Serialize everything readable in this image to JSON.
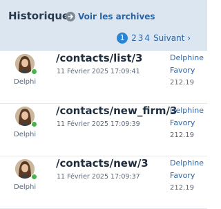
{
  "header": {
    "title": "Historique",
    "archives_label": "Voir les archives",
    "arrow_icon": "arrow-right-circle-icon"
  },
  "pagination": {
    "current": "1",
    "pages": [
      "2",
      "3",
      "4"
    ],
    "next_label": "Suivant ›"
  },
  "entries": [
    {
      "path": "/contacts/list/3",
      "date": "11 Février 2025 17:09:41",
      "user_short": "Delphi",
      "user_first": "Delphine",
      "user_last": "Favory",
      "ip": "212.19"
    },
    {
      "path": "/contacts/new_firm/3",
      "date": "11 Février 2025 17:09:39",
      "user_short": "Delphi",
      "user_first": "Delphine",
      "user_last": "Favory",
      "ip": "212.19"
    },
    {
      "path": "/contacts/new/3",
      "date": "11 Février 2025 17:09:37",
      "user_short": "Delphi",
      "user_first": "Delphine",
      "user_last": "Favory",
      "ip": "212.19"
    }
  ],
  "colors": {
    "header_bg": "#dbe6f1",
    "link": "#2a64a5",
    "page_active": "#2a86d4",
    "online": "#4caf50"
  }
}
